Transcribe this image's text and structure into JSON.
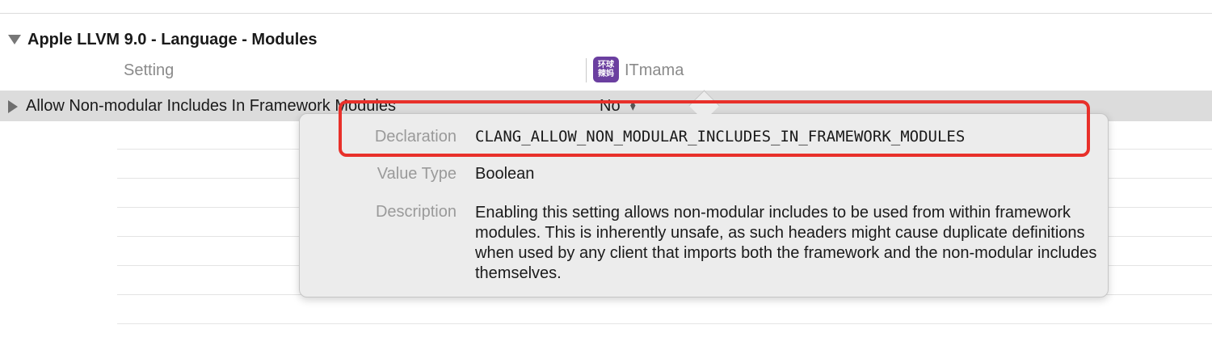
{
  "section": {
    "title": "Apple LLVM 9.0 - Language - Modules"
  },
  "columns": {
    "setting": "Setting",
    "target": "ITmama",
    "target_icon_text_line1": "环球",
    "target_icon_text_line2": "辣妈"
  },
  "selected_row": {
    "name": "Allow Non-modular Includes In Framework Modules",
    "value": "No"
  },
  "popover": {
    "declaration_label": "Declaration",
    "declaration_value": "CLANG_ALLOW_NON_MODULAR_INCLUDES_IN_FRAMEWORK_MODULES",
    "value_type_label": "Value Type",
    "value_type_value": "Boolean",
    "description_label": "Description",
    "description_value": "Enabling this setting allows non-modular includes to be used from within framework modules. This is inherently unsafe, as such headers might cause duplicate definitions when used by any client that imports both the framework and the non-modular includes themselves."
  },
  "colors": {
    "highlight": "#e8302a",
    "target_icon": "#6b3fa0",
    "selection": "#dcdcdc"
  }
}
